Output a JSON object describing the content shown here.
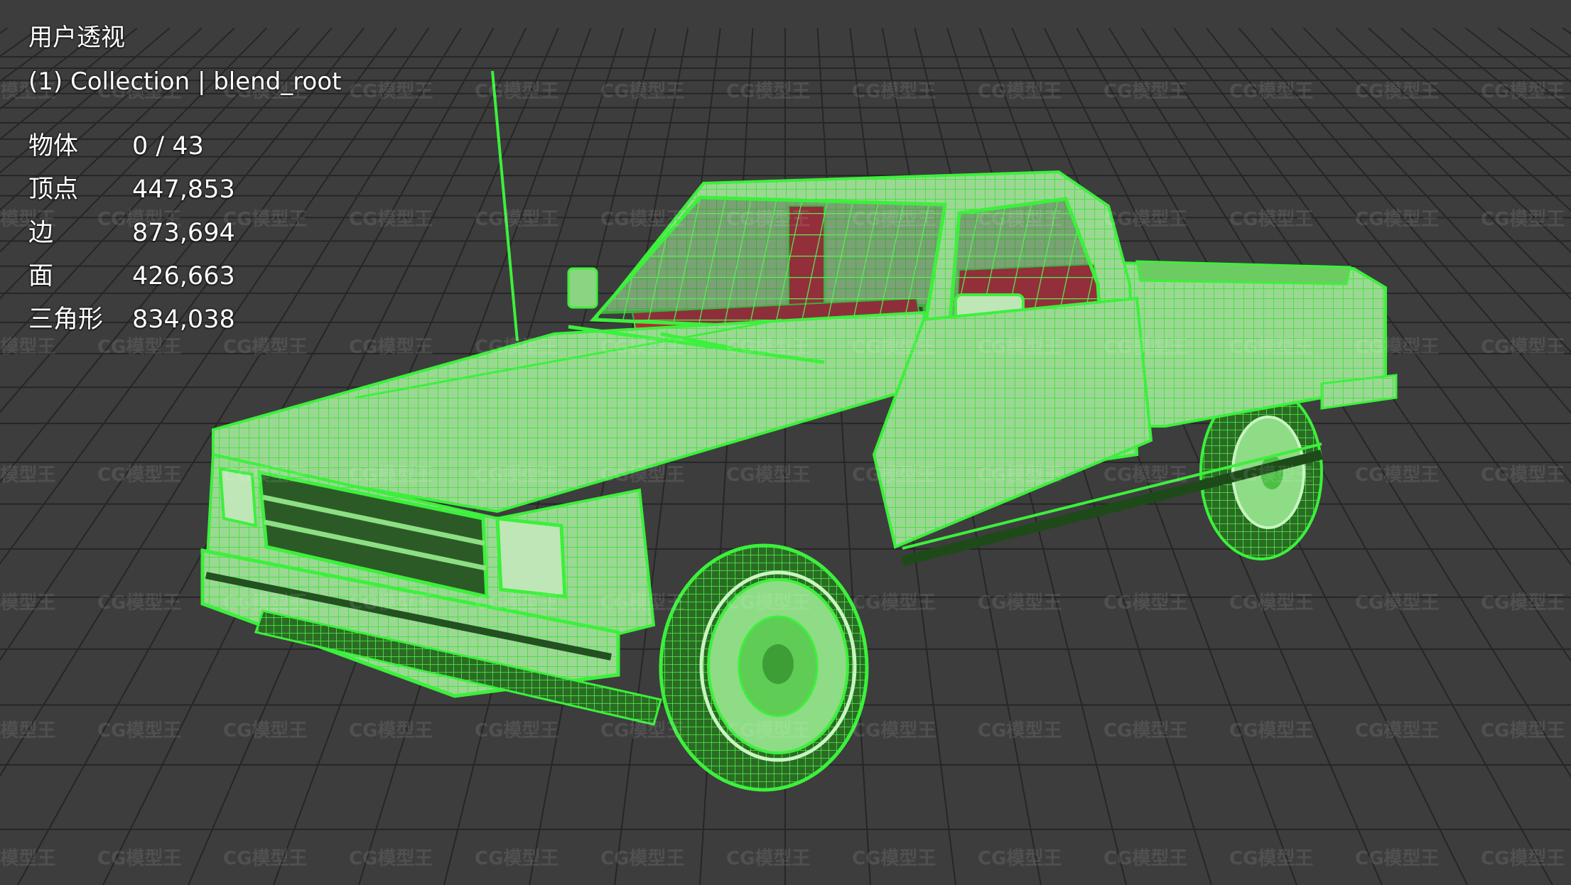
{
  "viewport": {
    "view_name": "用户透视",
    "collection": "(1) Collection | blend_root",
    "background_color": "#3d3d3d",
    "wire_color": "#3cf03c",
    "interior_color": "#c0283a"
  },
  "stats": [
    {
      "label": "物体",
      "value": "0 / 43"
    },
    {
      "label": "顶点",
      "value": "447,853"
    },
    {
      "label": "边",
      "value": "873,694"
    },
    {
      "label": "面",
      "value": "426,663"
    },
    {
      "label": "三角形",
      "value": "834,038"
    }
  ],
  "watermark": {
    "text": "CG模型王"
  },
  "model": {
    "icon": "pickup-truck-wireframe"
  }
}
